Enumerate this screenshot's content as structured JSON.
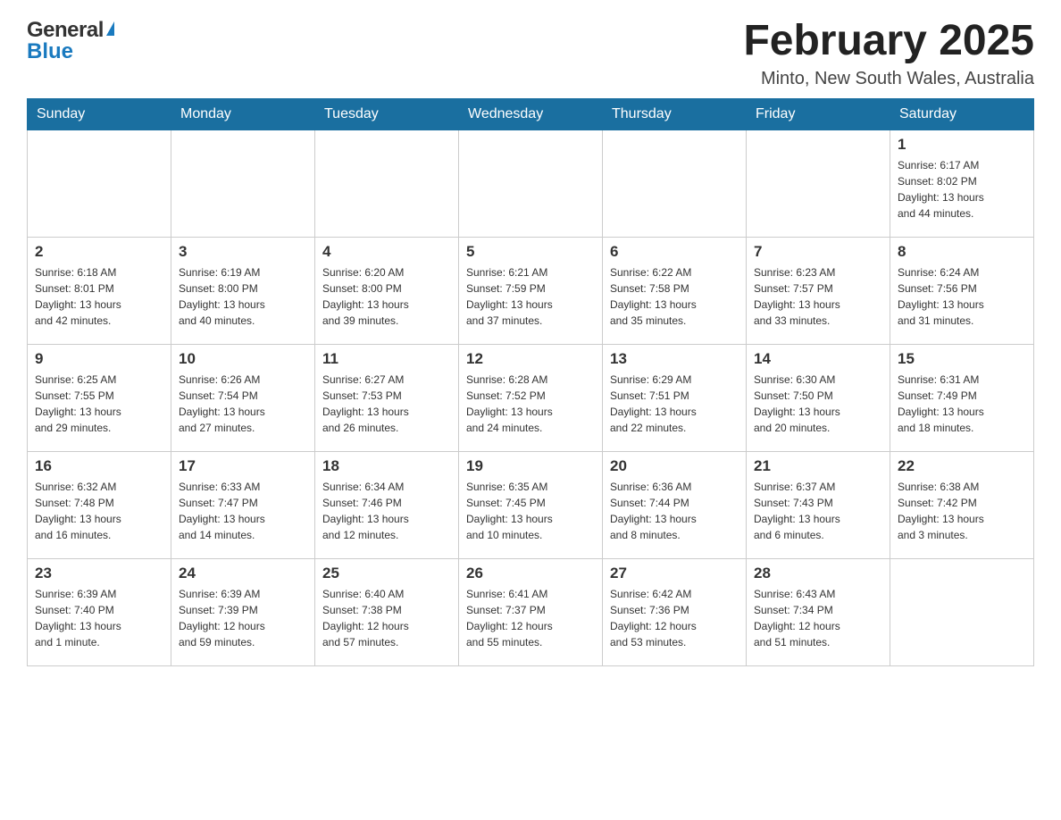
{
  "header": {
    "logo_general": "General",
    "logo_blue": "Blue",
    "title": "February 2025",
    "subtitle": "Minto, New South Wales, Australia"
  },
  "weekdays": [
    "Sunday",
    "Monday",
    "Tuesday",
    "Wednesday",
    "Thursday",
    "Friday",
    "Saturday"
  ],
  "weeks": [
    [
      {
        "day": "",
        "info": ""
      },
      {
        "day": "",
        "info": ""
      },
      {
        "day": "",
        "info": ""
      },
      {
        "day": "",
        "info": ""
      },
      {
        "day": "",
        "info": ""
      },
      {
        "day": "",
        "info": ""
      },
      {
        "day": "1",
        "info": "Sunrise: 6:17 AM\nSunset: 8:02 PM\nDaylight: 13 hours\nand 44 minutes."
      }
    ],
    [
      {
        "day": "2",
        "info": "Sunrise: 6:18 AM\nSunset: 8:01 PM\nDaylight: 13 hours\nand 42 minutes."
      },
      {
        "day": "3",
        "info": "Sunrise: 6:19 AM\nSunset: 8:00 PM\nDaylight: 13 hours\nand 40 minutes."
      },
      {
        "day": "4",
        "info": "Sunrise: 6:20 AM\nSunset: 8:00 PM\nDaylight: 13 hours\nand 39 minutes."
      },
      {
        "day": "5",
        "info": "Sunrise: 6:21 AM\nSunset: 7:59 PM\nDaylight: 13 hours\nand 37 minutes."
      },
      {
        "day": "6",
        "info": "Sunrise: 6:22 AM\nSunset: 7:58 PM\nDaylight: 13 hours\nand 35 minutes."
      },
      {
        "day": "7",
        "info": "Sunrise: 6:23 AM\nSunset: 7:57 PM\nDaylight: 13 hours\nand 33 minutes."
      },
      {
        "day": "8",
        "info": "Sunrise: 6:24 AM\nSunset: 7:56 PM\nDaylight: 13 hours\nand 31 minutes."
      }
    ],
    [
      {
        "day": "9",
        "info": "Sunrise: 6:25 AM\nSunset: 7:55 PM\nDaylight: 13 hours\nand 29 minutes."
      },
      {
        "day": "10",
        "info": "Sunrise: 6:26 AM\nSunset: 7:54 PM\nDaylight: 13 hours\nand 27 minutes."
      },
      {
        "day": "11",
        "info": "Sunrise: 6:27 AM\nSunset: 7:53 PM\nDaylight: 13 hours\nand 26 minutes."
      },
      {
        "day": "12",
        "info": "Sunrise: 6:28 AM\nSunset: 7:52 PM\nDaylight: 13 hours\nand 24 minutes."
      },
      {
        "day": "13",
        "info": "Sunrise: 6:29 AM\nSunset: 7:51 PM\nDaylight: 13 hours\nand 22 minutes."
      },
      {
        "day": "14",
        "info": "Sunrise: 6:30 AM\nSunset: 7:50 PM\nDaylight: 13 hours\nand 20 minutes."
      },
      {
        "day": "15",
        "info": "Sunrise: 6:31 AM\nSunset: 7:49 PM\nDaylight: 13 hours\nand 18 minutes."
      }
    ],
    [
      {
        "day": "16",
        "info": "Sunrise: 6:32 AM\nSunset: 7:48 PM\nDaylight: 13 hours\nand 16 minutes."
      },
      {
        "day": "17",
        "info": "Sunrise: 6:33 AM\nSunset: 7:47 PM\nDaylight: 13 hours\nand 14 minutes."
      },
      {
        "day": "18",
        "info": "Sunrise: 6:34 AM\nSunset: 7:46 PM\nDaylight: 13 hours\nand 12 minutes."
      },
      {
        "day": "19",
        "info": "Sunrise: 6:35 AM\nSunset: 7:45 PM\nDaylight: 13 hours\nand 10 minutes."
      },
      {
        "day": "20",
        "info": "Sunrise: 6:36 AM\nSunset: 7:44 PM\nDaylight: 13 hours\nand 8 minutes."
      },
      {
        "day": "21",
        "info": "Sunrise: 6:37 AM\nSunset: 7:43 PM\nDaylight: 13 hours\nand 6 minutes."
      },
      {
        "day": "22",
        "info": "Sunrise: 6:38 AM\nSunset: 7:42 PM\nDaylight: 13 hours\nand 3 minutes."
      }
    ],
    [
      {
        "day": "23",
        "info": "Sunrise: 6:39 AM\nSunset: 7:40 PM\nDaylight: 13 hours\nand 1 minute."
      },
      {
        "day": "24",
        "info": "Sunrise: 6:39 AM\nSunset: 7:39 PM\nDaylight: 12 hours\nand 59 minutes."
      },
      {
        "day": "25",
        "info": "Sunrise: 6:40 AM\nSunset: 7:38 PM\nDaylight: 12 hours\nand 57 minutes."
      },
      {
        "day": "26",
        "info": "Sunrise: 6:41 AM\nSunset: 7:37 PM\nDaylight: 12 hours\nand 55 minutes."
      },
      {
        "day": "27",
        "info": "Sunrise: 6:42 AM\nSunset: 7:36 PM\nDaylight: 12 hours\nand 53 minutes."
      },
      {
        "day": "28",
        "info": "Sunrise: 6:43 AM\nSunset: 7:34 PM\nDaylight: 12 hours\nand 51 minutes."
      },
      {
        "day": "",
        "info": ""
      }
    ]
  ]
}
